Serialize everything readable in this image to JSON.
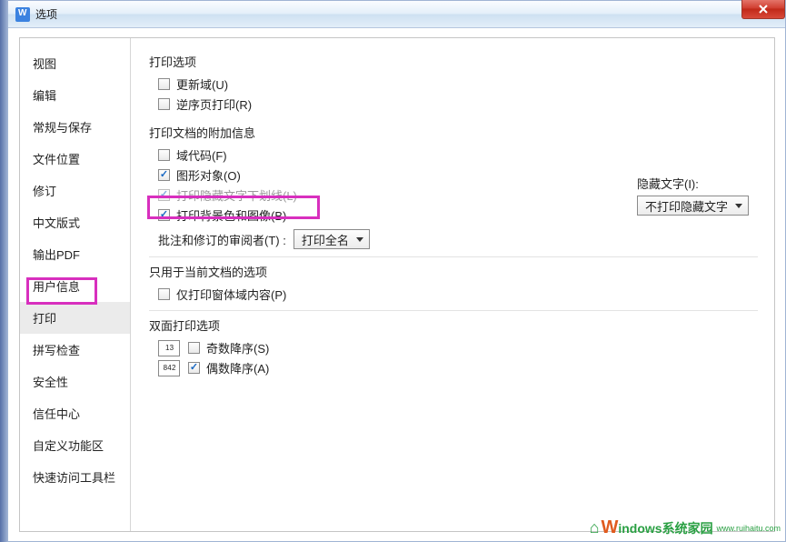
{
  "window": {
    "title": "选项"
  },
  "sidebar": {
    "items": [
      {
        "label": "视图"
      },
      {
        "label": "编辑"
      },
      {
        "label": "常规与保存"
      },
      {
        "label": "文件位置"
      },
      {
        "label": "修订"
      },
      {
        "label": "中文版式"
      },
      {
        "label": "输出PDF"
      },
      {
        "label": "用户信息"
      },
      {
        "label": "打印"
      },
      {
        "label": "拼写检查"
      },
      {
        "label": "安全性"
      },
      {
        "label": "信任中心"
      },
      {
        "label": "自定义功能区"
      },
      {
        "label": "快速访问工具栏"
      }
    ]
  },
  "sections": {
    "print_options": {
      "title": "打印选项",
      "update_fields": "更新域(U)",
      "reverse_order": "逆序页打印(R)"
    },
    "doc_addl": {
      "title": "打印文档的附加信息",
      "field_codes": "域代码(F)",
      "drawing_objects": "图形对象(O)",
      "hidden_underline": "打印隐藏文字下划线(L)",
      "bg_images": "打印背景色和图像(B)",
      "reviewer_label": "批注和修订的审阅者(T) :",
      "reviewer_value": "打印全名",
      "hidden_text_label": "隐藏文字(I):",
      "hidden_text_value": "不打印隐藏文字"
    },
    "current_doc": {
      "title": "只用于当前文档的选项",
      "form_fields": "仅打印窗体域内容(P)"
    },
    "duplex": {
      "title": "双面打印选项",
      "odd_desc": "奇数降序(S)",
      "even_desc": "偶数降序(A)",
      "odd_icon": "1 3",
      "even_icon": "8 4 2"
    }
  },
  "watermark": {
    "main": "indows系统家园",
    "sub": "www.ruihaitu.com"
  }
}
